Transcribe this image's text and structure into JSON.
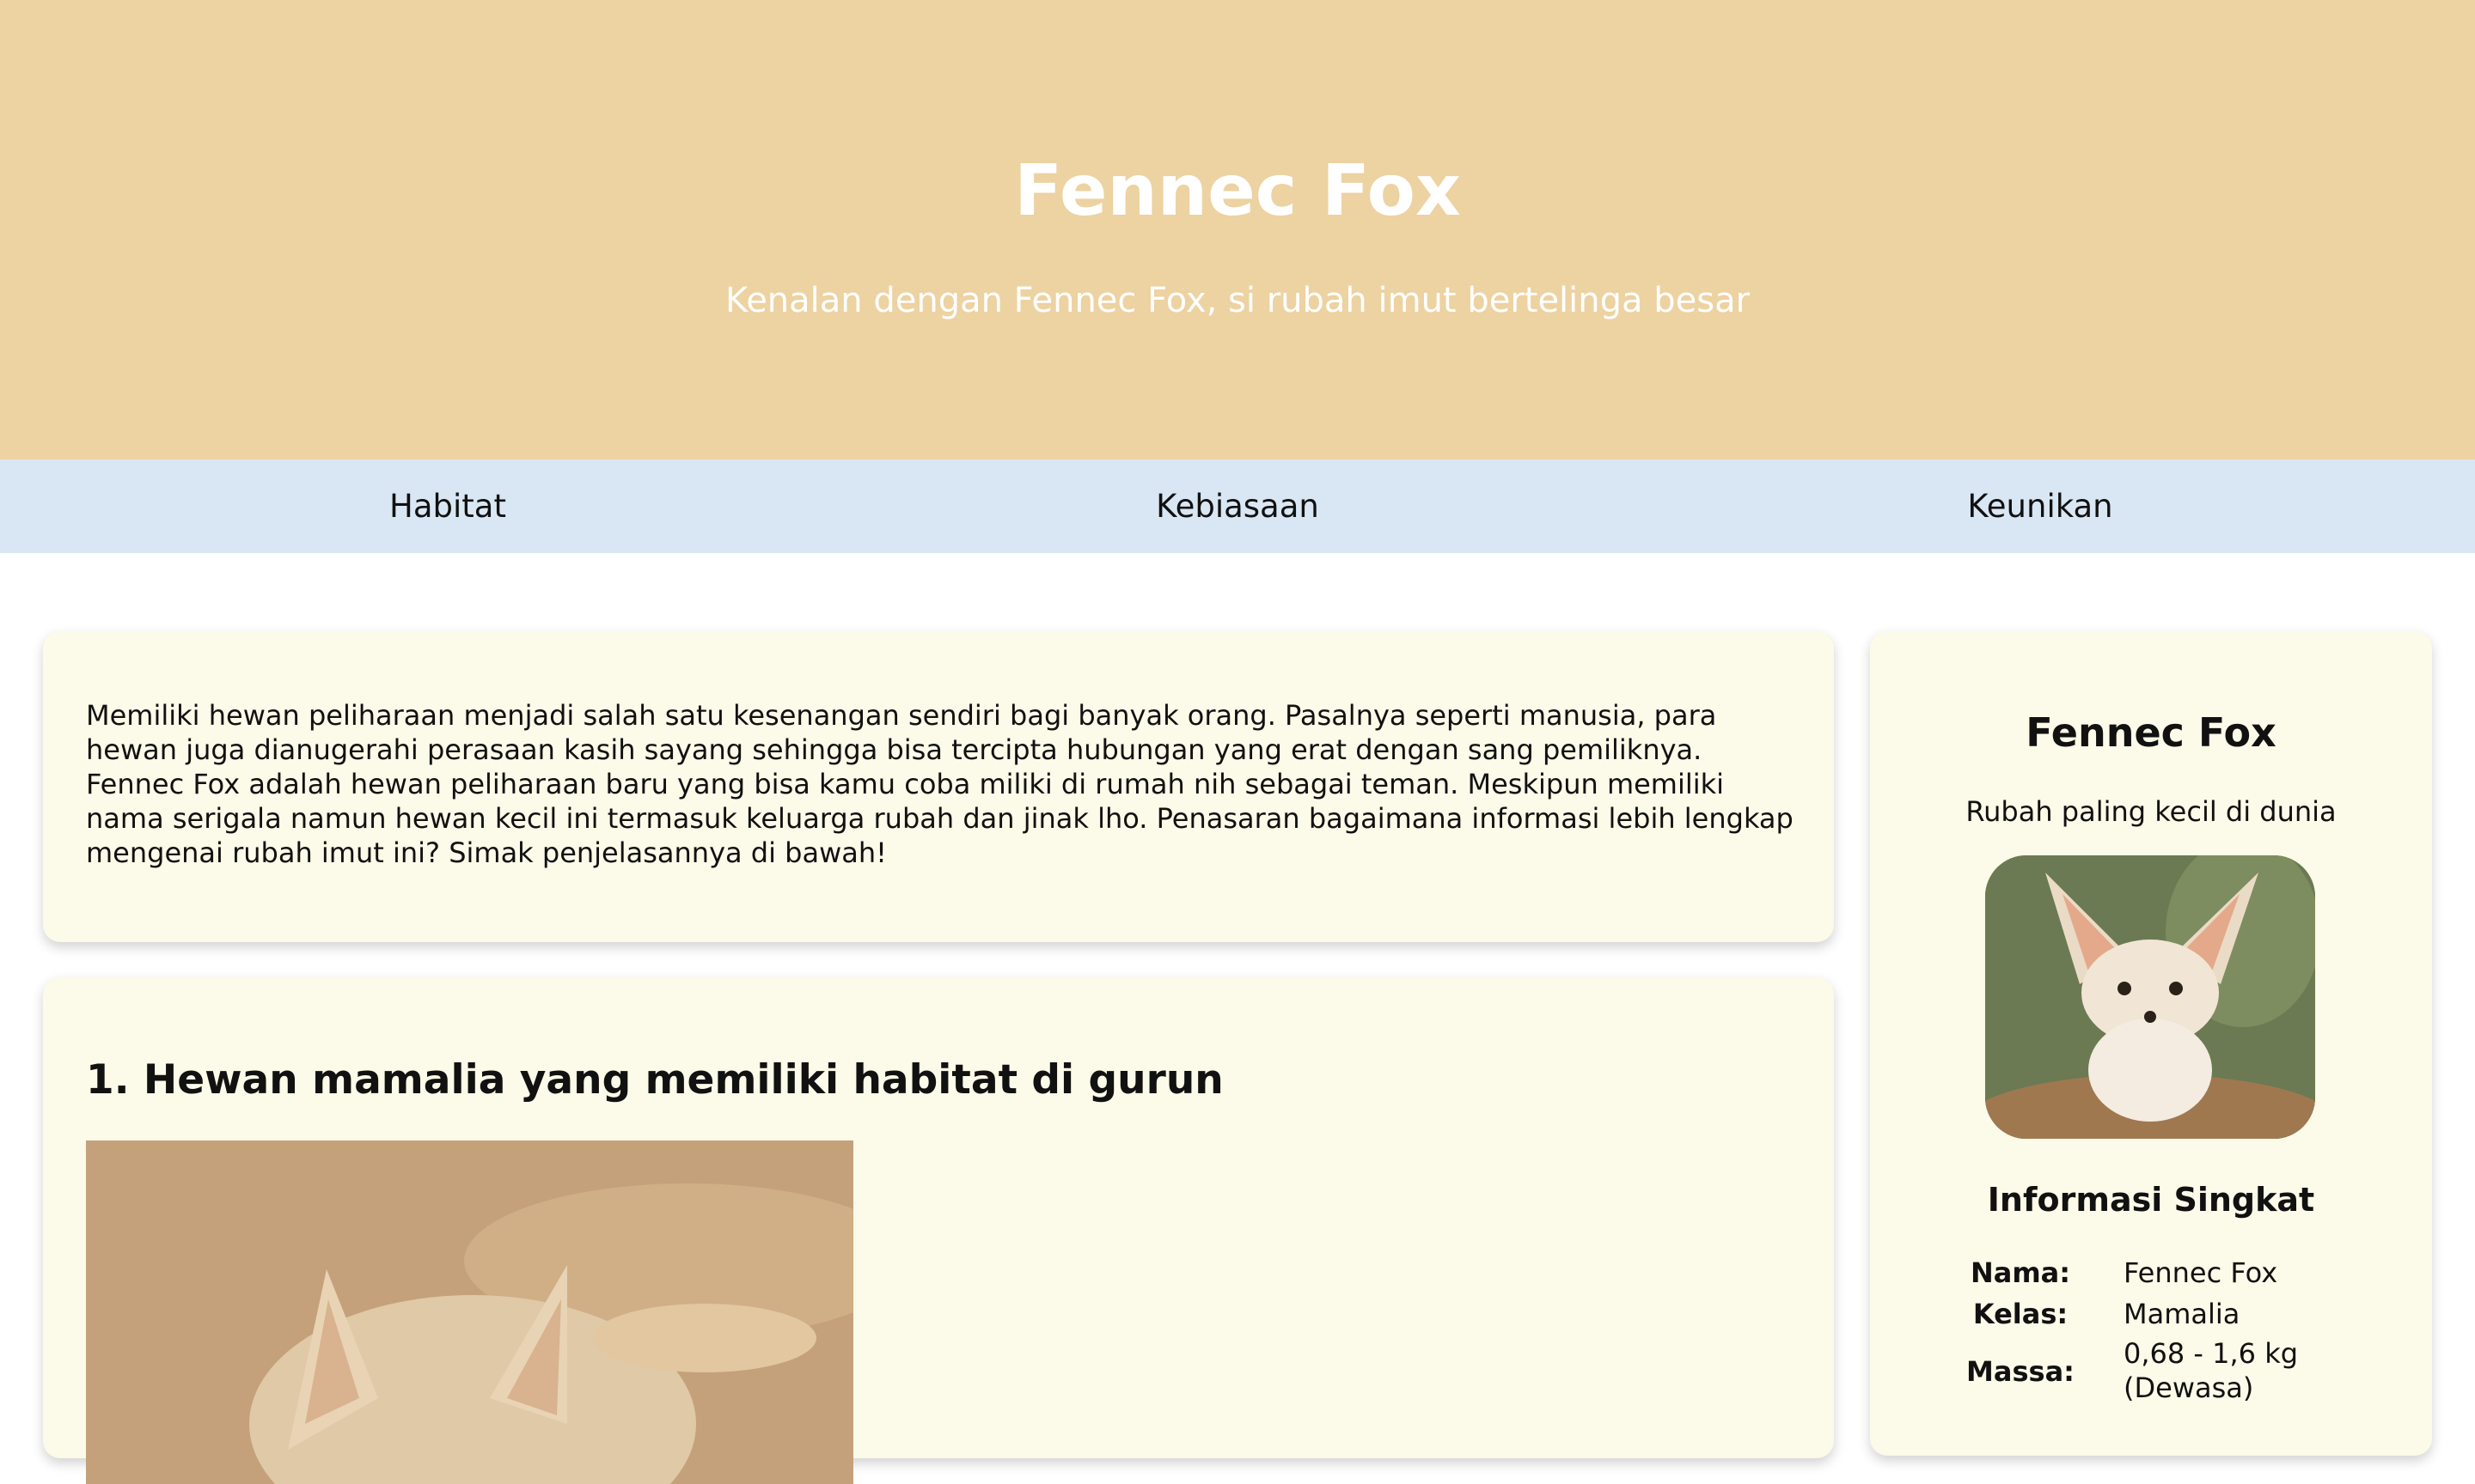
{
  "hero": {
    "title": "Fennec Fox",
    "subtitle": "Kenalan dengan Fennec Fox, si rubah imut bertelinga besar"
  },
  "nav": {
    "items": [
      {
        "label": "Habitat"
      },
      {
        "label": "Kebiasaan"
      },
      {
        "label": "Keunikan"
      }
    ]
  },
  "intro": {
    "text": "Memiliki hewan peliharaan menjadi salah satu kesenangan sendiri bagi banyak orang. Pasalnya seperti manusia, para hewan juga dianugerahi perasaan kasih sayang sehingga bisa tercipta hubungan yang erat dengan sang pemiliknya. Fennec Fox adalah hewan peliharaan baru yang bisa kamu coba miliki di rumah nih sebagai teman. Meskipun memiliki nama serigala namun hewan kecil ini termasuk keluarga rubah dan jinak lho. Penasaran bagaimana informasi lebih lengkap mengenai rubah imut ini? Simak penjelasannya di bawah!"
  },
  "section1": {
    "heading": "1. Hewan mamalia yang memiliki habitat di gurun"
  },
  "sidebar": {
    "title": "Fennec Fox",
    "subtitle": "Rubah paling kecil di dunia",
    "info_heading": "Informasi Singkat",
    "info": [
      {
        "key": "Nama:",
        "value": "Fennec Fox"
      },
      {
        "key": "Kelas:",
        "value": "Mamalia"
      },
      {
        "key": "Massa:",
        "value": "0,68 - 1,6 kg (Dewasa)"
      }
    ]
  },
  "colors": {
    "hero_bg": "#edd2a2",
    "nav_bg": "#d9e7f4",
    "card_bg": "#fcfae8"
  }
}
